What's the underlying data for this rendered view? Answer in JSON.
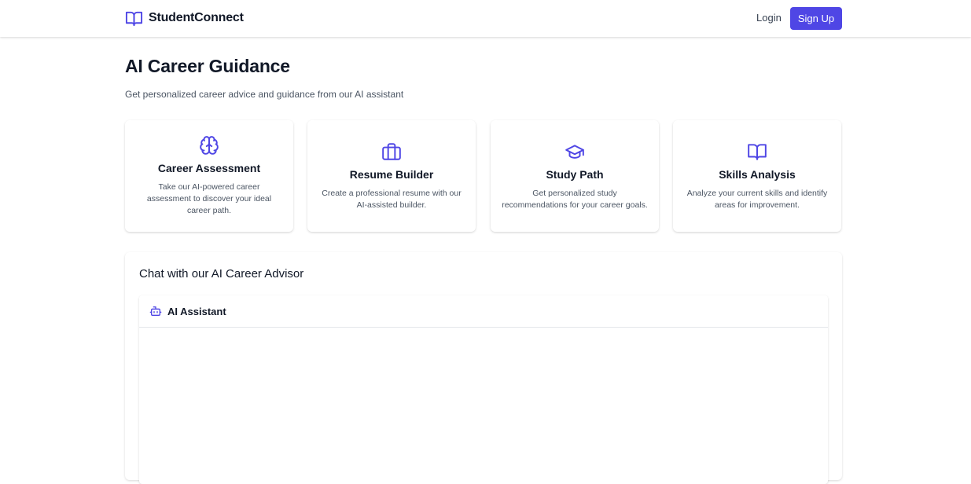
{
  "colors": {
    "accent": "#4f46e5",
    "text": "#111827",
    "muted": "#4b5563"
  },
  "nav": {
    "brand": "StudentConnect",
    "brand_icon": "book-open-icon",
    "login": "Login",
    "signup": "Sign Up"
  },
  "page": {
    "title": "AI Career Guidance",
    "subtitle": "Get personalized career advice and guidance from our AI assistant"
  },
  "cards": [
    {
      "icon": "brain-icon",
      "title": "Career Assessment",
      "description": "Take our AI-powered career assessment to discover your ideal career path."
    },
    {
      "icon": "briefcase-icon",
      "title": "Resume Builder",
      "description": "Create a professional resume with our AI-assisted builder."
    },
    {
      "icon": "graduation-cap-icon",
      "title": "Study Path",
      "description": "Get personalized study recommendations for your career goals."
    },
    {
      "icon": "book-open-icon",
      "title": "Skills Analysis",
      "description": "Analyze your current skills and identify areas for improvement."
    }
  ],
  "chat": {
    "heading": "Chat with our AI Career Advisor",
    "assistant_icon": "bot-icon",
    "assistant_title": "AI Assistant"
  }
}
